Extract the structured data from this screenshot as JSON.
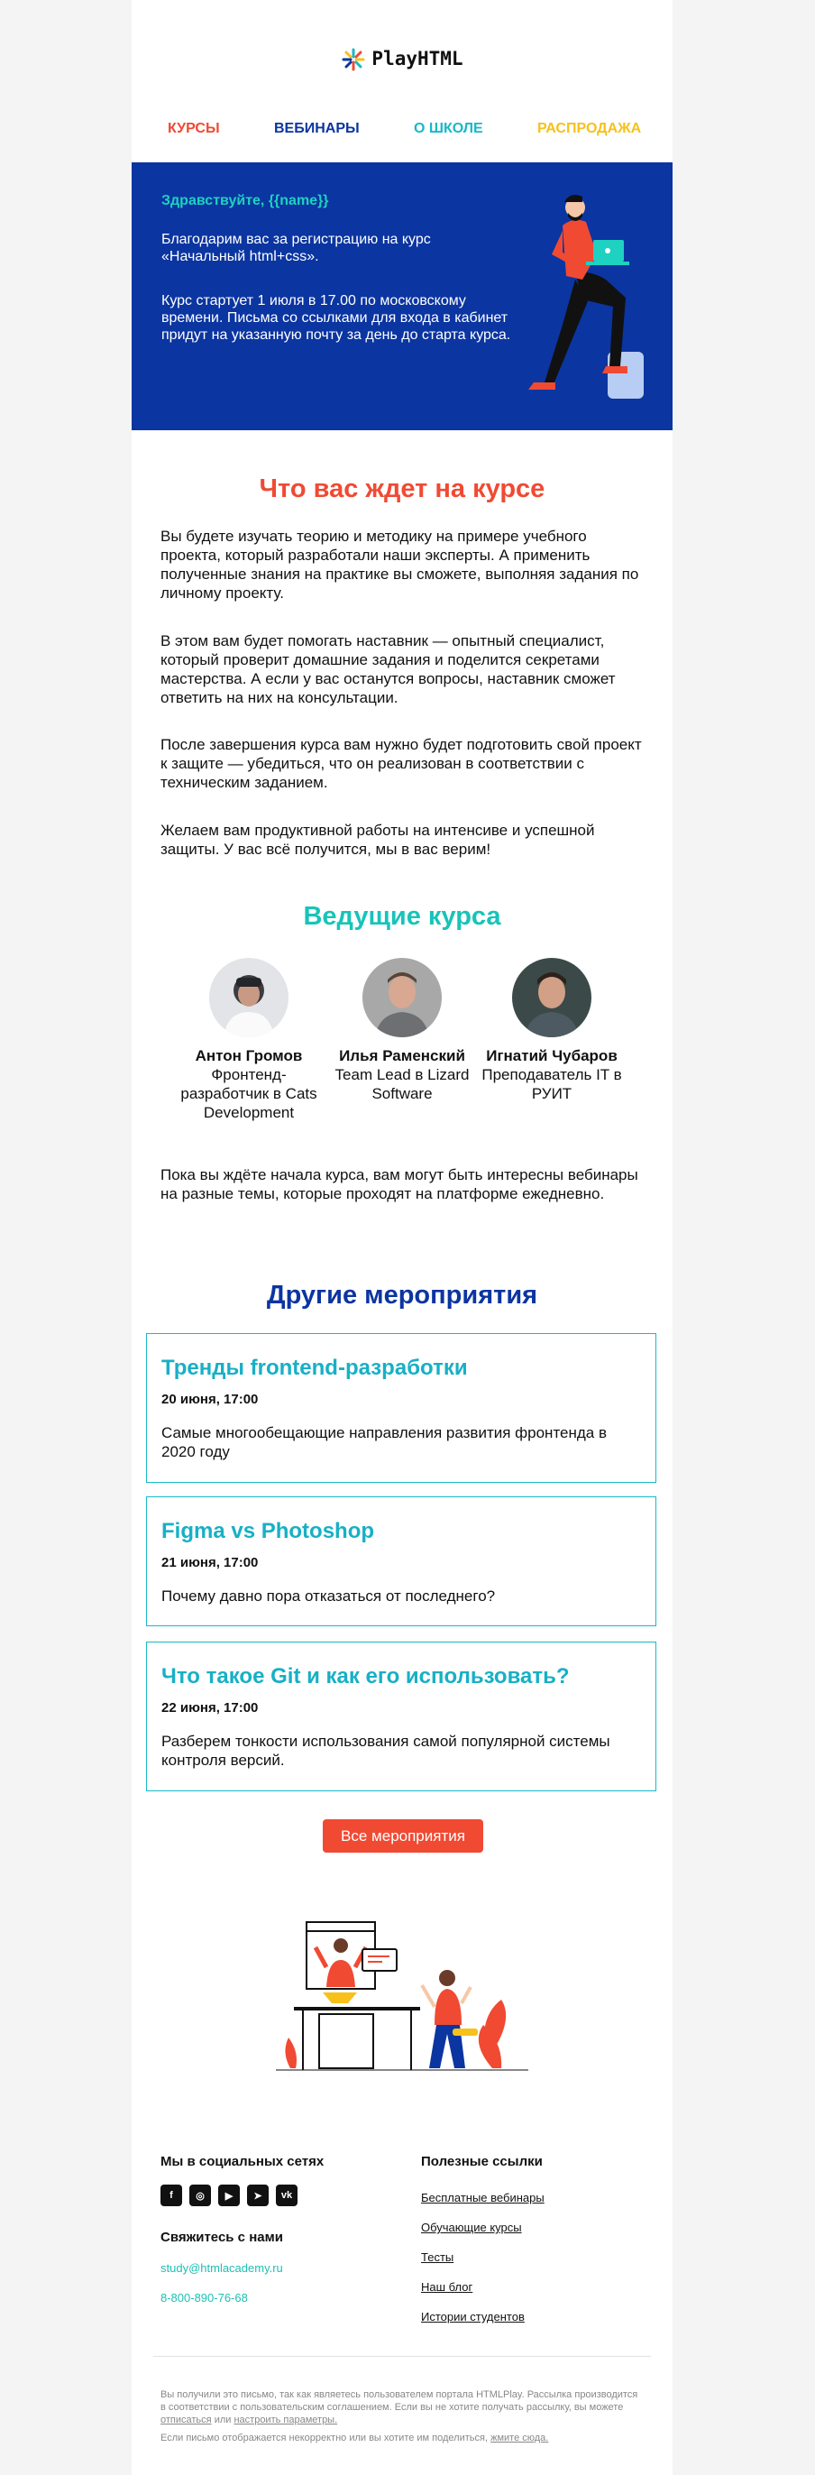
{
  "brand": {
    "name": "PlayHTML"
  },
  "nav": {
    "items": [
      {
        "label": "Курсы",
        "color": "#f04a33"
      },
      {
        "label": "Вебинары",
        "color": "#0b35a0"
      },
      {
        "label": "О школе",
        "color": "#17b8c9"
      },
      {
        "label": "Распродажа",
        "color": "#f7c11a"
      }
    ]
  },
  "hero": {
    "greeting": "Здравствуйте, {{name}}",
    "p1": "Благодарим вас за регистрацию на курс «Начальный html+css».",
    "p2": "Курс стартует 1 июля в 17.00 по московскому времени. Письма со ссылками для входа в кабинет придут на указанную почту за день до старта курса."
  },
  "course": {
    "title": "Что вас ждет на курсе",
    "paragraphs": [
      "Вы будете изучать теорию и методику на примере учебного проекта, который разработали наши эксперты. А применить полученные знания на практике вы сможете, выполняя задания по личному проекту.",
      "В этом вам будет помогать наставник — опытный специалист, который проверит домашние задания и поделится секретами мастерства. А если у вас останутся вопросы, наставник сможет ответить на них на консультации.",
      "После завершения курса вам нужно будет подготовить свой проект к защите — убедиться, что он реализован в соответствии с техническим заданием.",
      "Желаем вам продуктивной работы на интенсиве и успешной защиты. У вас всё получится, мы в вас верим!"
    ]
  },
  "teachers": {
    "title": "Ведущие курса",
    "items": [
      {
        "name": "Антон Громов",
        "role": "Фронтенд-разработчик в Cats Development"
      },
      {
        "name": "Илья Раменский",
        "role": "Team Lead в Lizard Software"
      },
      {
        "name": "Игнатий Чубаров",
        "role": "Преподаватель IT в РУИТ"
      }
    ],
    "note": "Пока вы ждёте начала курса, вам могут быть интересны вебинары на разные темы, которые проходят на платформе ежедневно."
  },
  "events": {
    "title": "Другие мероприятия",
    "items": [
      {
        "title": "Тренды frontend-разработки",
        "date": "20 июня, 17:00",
        "text": "Самые многообещающие направления развития фронтенда в 2020 году"
      },
      {
        "title": "Figma vs Photoshop",
        "date": "21 июня, 17:00",
        "text": "Почему давно пора отказаться от последнего?"
      },
      {
        "title": "Что такое Git и как его использовать?",
        "date": "22 июня, 17:00",
        "text": "Разберем тонкости использования самой популярной системы контроля версий."
      }
    ],
    "button": "Все мероприятия"
  },
  "footer": {
    "social_title": "Мы в социальных сетях",
    "social_icons": [
      "facebook-icon",
      "instagram-icon",
      "youtube-icon",
      "telegram-icon",
      "vk-icon"
    ],
    "contact_title": "Свяжитесь с нами",
    "email": "study@htmlacademy.ru",
    "phone": "8-800-890-76-68",
    "links_title": "Полезные ссылки",
    "links": [
      "Бесплатные вебинары",
      "Обучающие курсы",
      "Тесты",
      "Наш блог",
      "Истории студентов"
    ],
    "legal1": "Вы получили это письмо, так как являетесь пользователем портала HTMLPlay. Рассылка производится в соответствии с пользовательским соглашением. Если вы не хотите получать рассылку, вы можете",
    "unsubscribe": "отписаться",
    "or": "или",
    "settings": "настроить параметры.",
    "legal2": "Если письмо отображается некорректно или вы хотите им поделиться,",
    "view_link": "жмите сюда."
  },
  "colors": {
    "red": "#f04a33",
    "blue": "#0b35a0",
    "teal": "#17b8c9",
    "yellow": "#f7c11a"
  }
}
